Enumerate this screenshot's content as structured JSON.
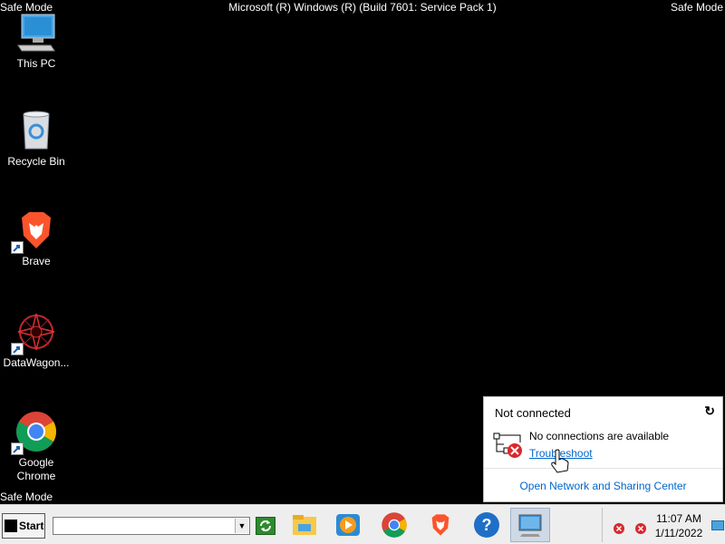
{
  "overlay": {
    "safe_mode_tl": "Safe Mode",
    "safe_mode_tr": "Safe Mode",
    "safe_mode_bl": "Safe Mode",
    "build": "Microsoft (R) Windows (R) (Build 7601: Service Pack 1)"
  },
  "desktop": {
    "icons": [
      {
        "label": "This PC",
        "icon": "computer-icon"
      },
      {
        "label": "Recycle Bin",
        "icon": "recycle-bin-icon"
      },
      {
        "label": "Brave",
        "icon": "brave-icon"
      },
      {
        "label": "DataWagon...",
        "icon": "datawagon-icon"
      },
      {
        "label": "Google\nChrome",
        "icon": "chrome-icon"
      }
    ]
  },
  "network_flyout": {
    "title": "Not connected",
    "refresh_icon": "refresh-icon",
    "message": "No connections are available",
    "troubleshoot": "Troubleshoot",
    "open_center": "Open Network and Sharing Center"
  },
  "taskbar": {
    "start_label": "Start",
    "address_value": "",
    "apps": [
      "file-explorer-icon",
      "media-player-icon",
      "chrome-icon",
      "brave-icon",
      "help-icon",
      "network-monitor-icon"
    ],
    "clock_time": "11:07 AM",
    "clock_date": "1/11/2022"
  },
  "colors": {
    "desktop_bg": "#000000",
    "link": "#0066cc",
    "taskbar_bg": "#eeeeee"
  }
}
